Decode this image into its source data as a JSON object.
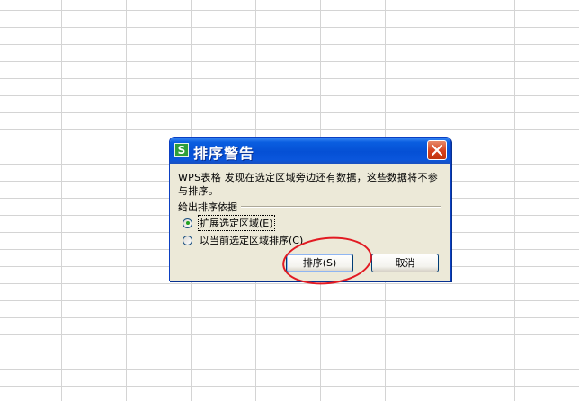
{
  "dialog": {
    "app_icon": "S",
    "title": "排序警告",
    "message": "WPS表格 发现在选定区域旁边还有数据，这些数据将不参与排序。",
    "group_label": "给出排序依据",
    "options": [
      {
        "label": "扩展选定区域(E)",
        "checked": true
      },
      {
        "label": "以当前选定区域排序(C)",
        "checked": false
      }
    ],
    "sort_button": "排序(S)",
    "cancel_button": "取消"
  },
  "colors": {
    "title_bar": "#0550d5",
    "dialog_bg": "#ece9d8",
    "close_button": "#d4401c",
    "annotation": "#e21a22",
    "grid_line": "#d4d4d4"
  },
  "icons": {
    "app": "wps-spreadsheet-icon",
    "close": "close-icon"
  }
}
